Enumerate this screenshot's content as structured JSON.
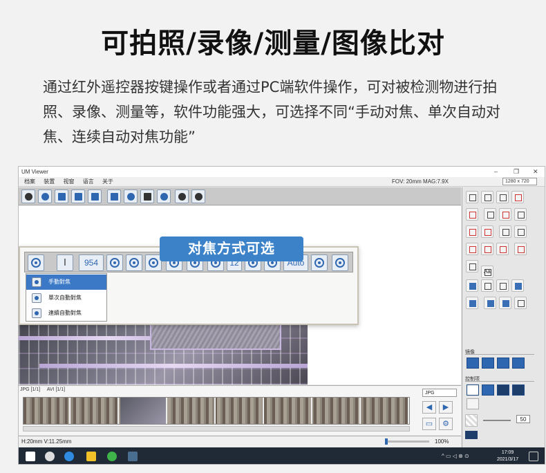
{
  "headline": "可拍照/录像/测量/图像比对",
  "description": "通过红外遥控器按键操作或者通过PC端软件操作，可对被检测物进行拍照、录像、测量等，软件功能强大，可选择不同“手动对焦、单次自动对焦、连续自动对焦功能”",
  "app": {
    "window_title": "UM Viewer",
    "window_controls": [
      "–",
      "❐",
      "✕"
    ],
    "menus": [
      "档案",
      "装置",
      "视窗",
      "语言",
      "关于"
    ],
    "fov_readout": "FOV: 20mm  MAG:7.9X",
    "resolution": "1280 x 720"
  },
  "zoom_toolbar": {
    "focus_value": "954",
    "step_value": "12",
    "auto_label": "Auto"
  },
  "focus_menu": {
    "items": [
      "手動對焦",
      "單次自動對焦",
      "連續自動對焦"
    ],
    "selected_index": 0
  },
  "callout": "对焦方式可选",
  "right_panel": {
    "aa_label": "Aa",
    "mirror_header": "镜像",
    "control_header": "控制项",
    "value": "50"
  },
  "thumbnails": {
    "tabs": [
      "JPG [1/1]",
      "AVI [1/1]"
    ],
    "format": "JPG"
  },
  "status": {
    "dimensions": "H:20mm V:11.25mm",
    "zoom": "100%"
  },
  "taskbar": {
    "time": "17:09",
    "date": "2021/3/17"
  },
  "colors": {
    "accent": "#3b82c9",
    "menu_selected": "#3b78c6"
  }
}
